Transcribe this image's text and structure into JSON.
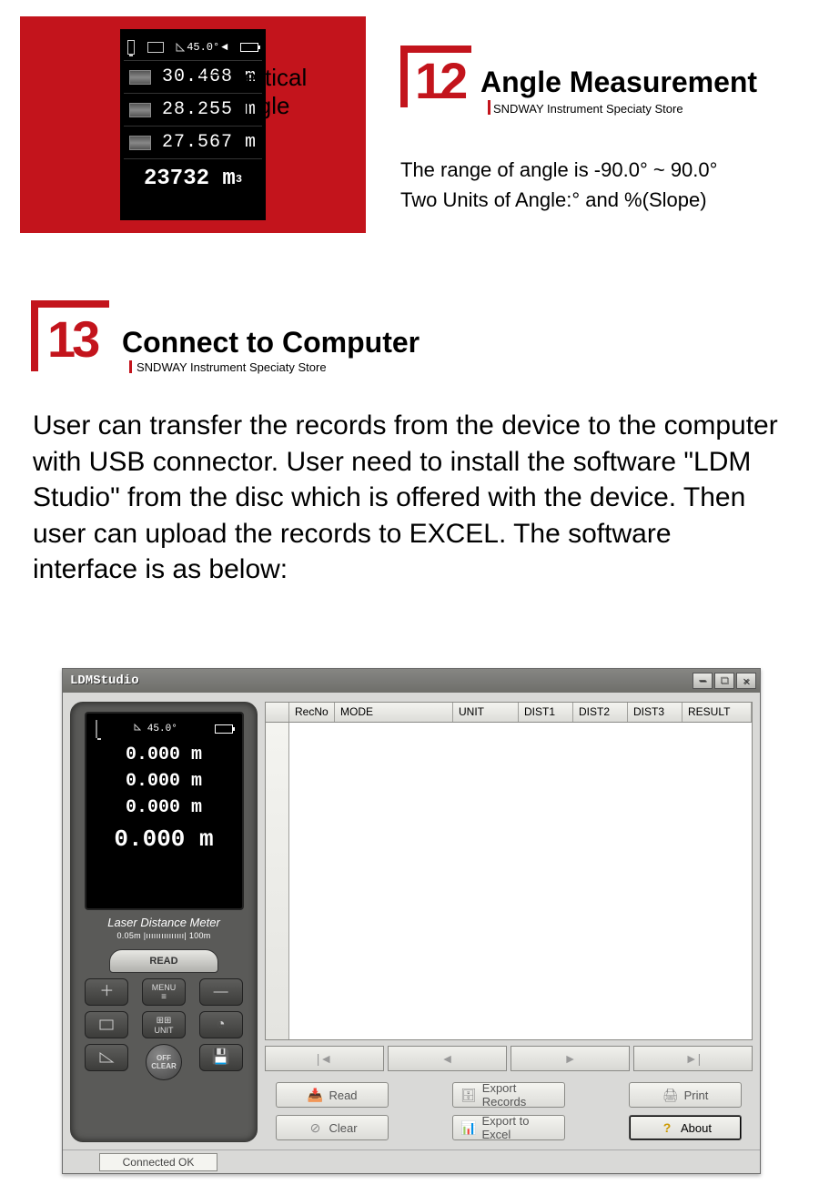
{
  "device_display": {
    "angle": "45.0°",
    "rows": [
      "30.468 m",
      "28.255 m",
      "27.567 m"
    ],
    "total": "23732 m",
    "total_exp": "3"
  },
  "pointer_label": "Vertical Angle",
  "section12": {
    "num": "12",
    "title": "Angle Measurement",
    "sub": "SNDWAY Instrument Speciaty Store",
    "line1": "The range of angle is -90.0° ~ 90.0°",
    "line2": "Two Units of Angle:° and %(Slope)"
  },
  "section13": {
    "num": "13",
    "title": "Connect to Computer",
    "sub": "SNDWAY Instrument Speciaty Store",
    "body": "User can transfer the records from the device to the computer with USB connector. User need to install the software \"LDM Studio\" from the disc which is offered with the device. Then user can upload the records to EXCEL. The software interface is as below:"
  },
  "app": {
    "title": "LDMStudio",
    "device_screen": {
      "angle": "45.0°",
      "rows": [
        "0.000  m",
        "0.000  m",
        "0.000  m"
      ],
      "big": "0.000  m",
      "label": "Laser Distance Meter",
      "scale": "0.05m |ııııııııııııııı| 100m"
    },
    "keys": {
      "read": "READ",
      "menu": "MENU",
      "unit": "UNIT",
      "off_clear_top": "OFF",
      "off_clear_bot": "CLEAR"
    },
    "grid": {
      "headers": [
        "RecNo",
        "MODE",
        "UNIT",
        "DIST1",
        "DIST2",
        "DIST3",
        "RESULT"
      ]
    },
    "nav": {
      "first": "|◄",
      "prev": "◄",
      "next": "►",
      "last": "►|"
    },
    "actions": {
      "read": "Read",
      "export_records": "Export Records",
      "print": "Print",
      "clear": "Clear",
      "export_excel": "Export to Excel",
      "about": "About"
    },
    "status": "Connected OK"
  }
}
